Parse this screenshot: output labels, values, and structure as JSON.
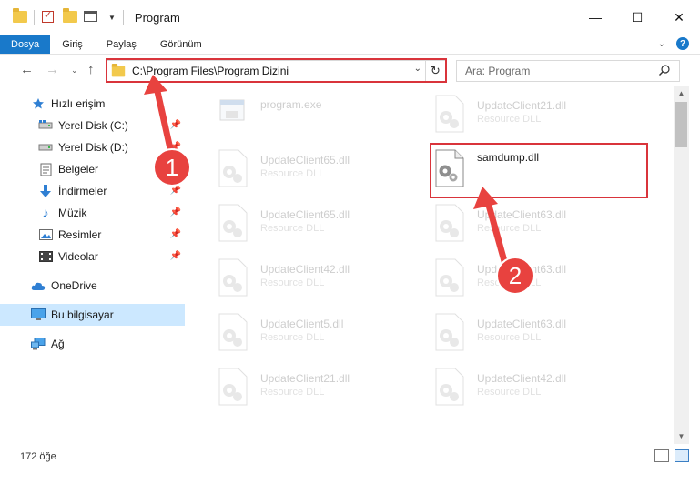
{
  "window": {
    "title": "Program",
    "minimize": "—",
    "maximize": "☐",
    "close": "✕"
  },
  "ribbon": {
    "tabs": [
      "Dosya",
      "Giriş",
      "Paylaş",
      "Görünüm"
    ]
  },
  "address": {
    "path": "C:\\Program Files\\Program Dizini",
    "search_placeholder": "Ara: Program"
  },
  "sidebar": {
    "items": [
      {
        "label": "Hızlı erişim",
        "icon": "star-icon"
      },
      {
        "label": "Yerel Disk (C:)",
        "icon": "drive-icon",
        "pinned": true
      },
      {
        "label": "Yerel Disk (D:)",
        "icon": "drive-icon",
        "pinned": true
      },
      {
        "label": "Belgeler",
        "icon": "documents-icon",
        "pinned": true
      },
      {
        "label": "İndirmeler",
        "icon": "download-icon",
        "pinned": true
      },
      {
        "label": "Müzik",
        "icon": "music-icon",
        "pinned": true
      },
      {
        "label": "Resimler",
        "icon": "pictures-icon",
        "pinned": true
      },
      {
        "label": "Videolar",
        "icon": "videos-icon",
        "pinned": true
      },
      {
        "label": "OneDrive",
        "icon": "cloud-icon"
      },
      {
        "label": "Bu bilgisayar",
        "icon": "computer-icon",
        "selected": true
      },
      {
        "label": "Ağ",
        "icon": "network-icon"
      }
    ]
  },
  "files": [
    {
      "name": "program.exe",
      "type": ""
    },
    {
      "name": "UpdateClient21.dll",
      "type": "Resource DLL"
    },
    {
      "name": "UpdateClient65.dll",
      "type": "Resource DLL"
    },
    {
      "name": "samdump.dll",
      "type": ""
    },
    {
      "name": "UpdateClient65.dll",
      "type": "Resource DLL"
    },
    {
      "name": "UpdateClient63.dll",
      "type": "Resource DLL"
    },
    {
      "name": "UpdateClient42.dll",
      "type": "Resource DLL"
    },
    {
      "name": "UpdateClient63.dll",
      "type": "Resource DLL"
    },
    {
      "name": "UpdateClient5.dll",
      "type": "Resource DLL"
    },
    {
      "name": "UpdateClient63.dll",
      "type": "Resource DLL"
    },
    {
      "name": "UpdateClient21.dll",
      "type": "Resource DLL"
    },
    {
      "name": "UpdateClient42.dll",
      "type": "Resource DLL"
    }
  ],
  "status": {
    "item_count": "172 öğe"
  },
  "annotations": {
    "step1": "1",
    "step2": "2",
    "color": "#e8423f"
  },
  "colors": {
    "accent": "#1979ca",
    "highlight": "#d9343b",
    "selected_bg": "#cce8ff"
  }
}
